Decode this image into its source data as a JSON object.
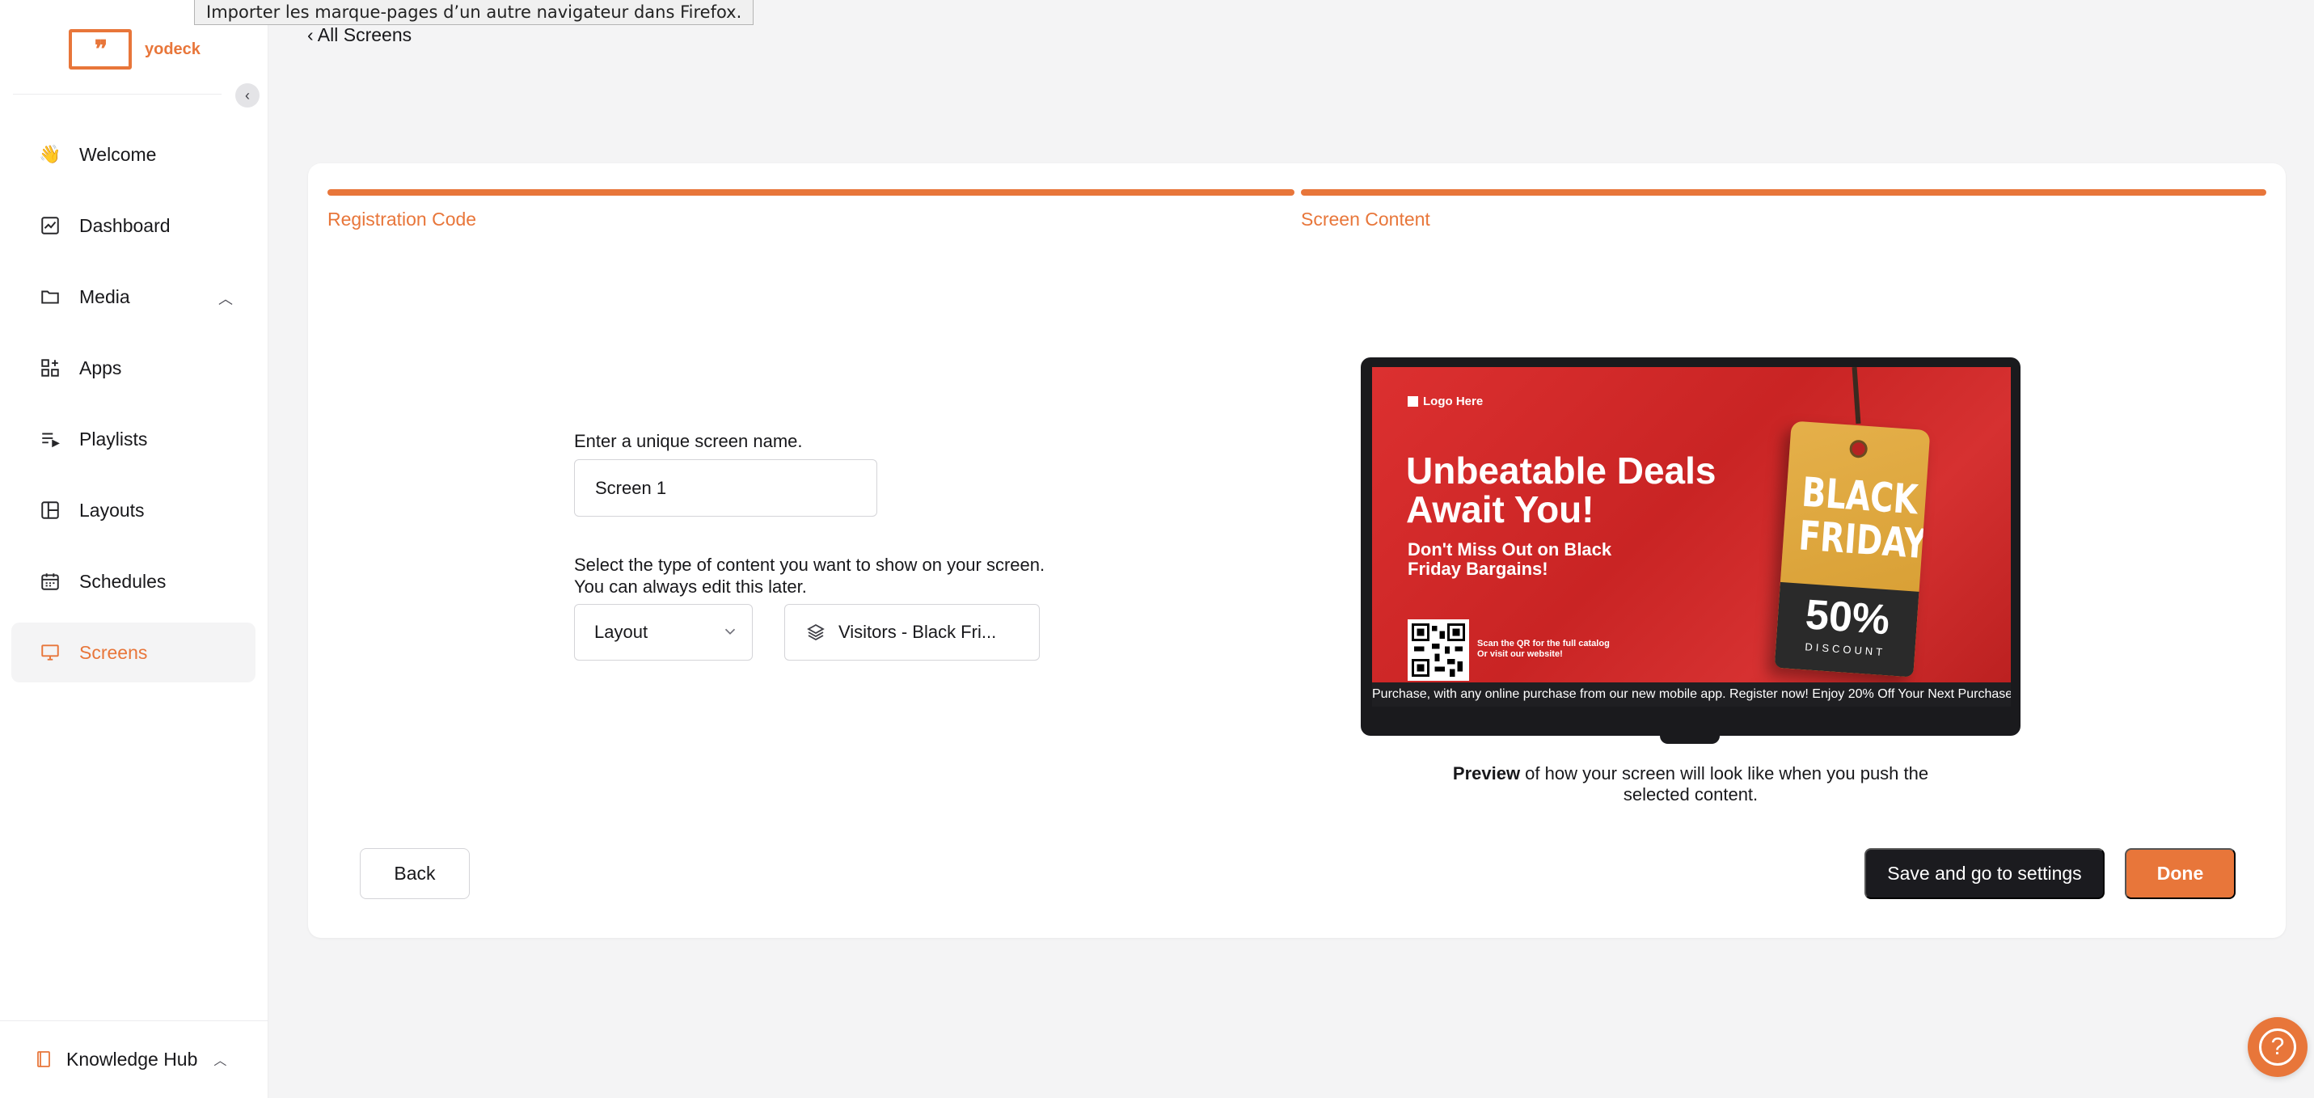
{
  "tooltip": {
    "text": "Importer les marque-pages d’un autre navigateur dans Firefox."
  },
  "brand": {
    "logo_mark": "❞",
    "name": "yodeck",
    "accent": "#e8763a"
  },
  "sidebar": {
    "collapse_icon": "chevron-left-icon",
    "items": [
      {
        "label": "Welcome",
        "icon": "wave-hand-icon"
      },
      {
        "label": "Dashboard",
        "icon": "chart-icon"
      },
      {
        "label": "Media",
        "icon": "folder-icon",
        "expanded": true
      },
      {
        "label": "Apps",
        "icon": "apps-icon"
      },
      {
        "label": "Playlists",
        "icon": "playlist-icon"
      },
      {
        "label": "Layouts",
        "icon": "layout-icon"
      },
      {
        "label": "Schedules",
        "icon": "calendar-icon"
      },
      {
        "label": "Screens",
        "icon": "monitor-icon",
        "active": true
      }
    ],
    "knowledge_hub": "Knowledge Hub"
  },
  "nav": {
    "back_label": "‹ All Screens"
  },
  "steps": [
    {
      "label": "Registration Code",
      "complete": true
    },
    {
      "label": "Screen Content",
      "complete": true
    }
  ],
  "form": {
    "name_label": "Enter a unique screen name.",
    "name_value": "Screen 1",
    "content_label_1": "Select the type of content you want to show on your screen.",
    "content_label_2": "You can always edit this later.",
    "type_value": "Layout",
    "layout_value": "Visitors - Black Fri..."
  },
  "preview": {
    "logo_text": "Logo Here",
    "headline": "Unbeatable Deals Await You!",
    "subline": "Don't Miss Out on Black Friday Bargains!",
    "qr_text_1": "Scan the QR for the full catalog",
    "qr_text_2": "Or visit our website!",
    "tag_title": "BLACK FRIDAY",
    "tag_percent": "50%",
    "tag_discount": "DISCOUNT",
    "ticker": "Purchase, with any online purchase from our new mobile app. Register now! Enjoy 20% Off Your Next Purchase",
    "caption_bold": "Preview",
    "caption_rest": " of how your screen will look like when you push the selected content."
  },
  "actions": {
    "back": "Back",
    "save": "Save and go to settings",
    "done": "Done"
  },
  "help": {
    "icon": "help-icon",
    "glyph": "?"
  }
}
